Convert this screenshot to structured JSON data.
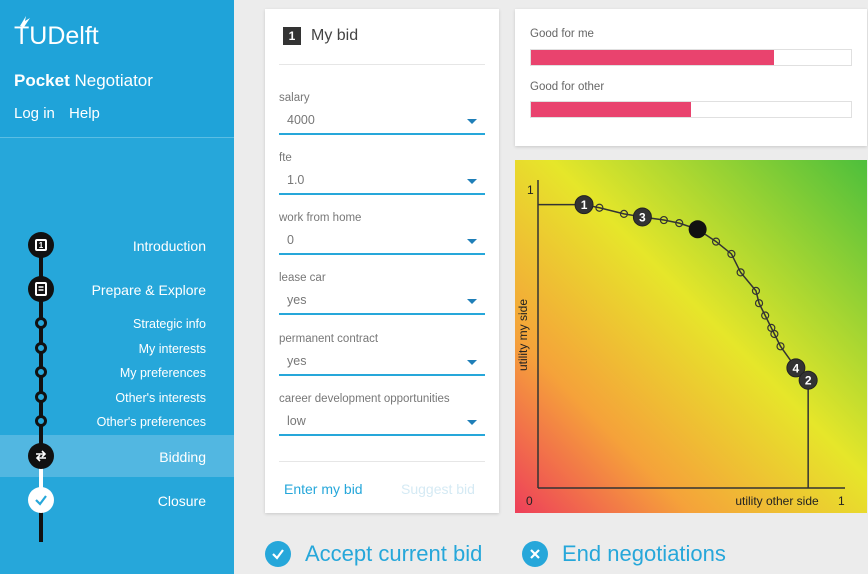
{
  "sidebar": {
    "logo": "TUDelft",
    "app_title_bold": "Pocket",
    "app_title_rest": " Negotiator",
    "login": "Log in",
    "help": "Help",
    "steps": {
      "introduction": "Introduction",
      "prepare": "Prepare & Explore",
      "strategic": "Strategic info",
      "my_interests": "My interests",
      "my_preferences": "My preferences",
      "others_interests": "Other's interests",
      "others_preferences": "Other's preferences",
      "bidding": "Bidding",
      "closure": "Closure"
    },
    "step1_badge": "1"
  },
  "bid": {
    "badge": "1",
    "title": "My bid",
    "fields": [
      {
        "label": "salary",
        "value": "4000"
      },
      {
        "label": "fte",
        "value": "1.0"
      },
      {
        "label": "work from home",
        "value": "0"
      },
      {
        "label": "lease car",
        "value": "yes"
      },
      {
        "label": "permanent contract",
        "value": "yes"
      },
      {
        "label": "career development opportunities",
        "value": "low"
      }
    ],
    "enter_label": "Enter my bid",
    "suggest_label": "Suggest bid"
  },
  "utility": {
    "me_label": "Good for me",
    "me_value": 0.76,
    "other_label": "Good for other",
    "other_value": 0.5,
    "bar_color": "#e9436e"
  },
  "chart_data": {
    "type": "scatter",
    "xlabel": "utility other side",
    "ylabel": "utility my side",
    "x_tick_min": "0",
    "x_tick_max": "1",
    "y_tick_max": "1",
    "xlim": [
      0,
      1
    ],
    "ylim": [
      0,
      1
    ],
    "pareto_points": [
      {
        "x": 0.0,
        "y": 0.92
      },
      {
        "x": 0.15,
        "y": 0.92,
        "label": "1"
      },
      {
        "x": 0.2,
        "y": 0.91
      },
      {
        "x": 0.28,
        "y": 0.89
      },
      {
        "x": 0.34,
        "y": 0.88,
        "label": "3"
      },
      {
        "x": 0.41,
        "y": 0.87
      },
      {
        "x": 0.46,
        "y": 0.86
      },
      {
        "x": 0.52,
        "y": 0.84,
        "highlight": true
      },
      {
        "x": 0.58,
        "y": 0.8
      },
      {
        "x": 0.63,
        "y": 0.76
      },
      {
        "x": 0.66,
        "y": 0.7
      },
      {
        "x": 0.71,
        "y": 0.64
      },
      {
        "x": 0.72,
        "y": 0.6
      },
      {
        "x": 0.74,
        "y": 0.56
      },
      {
        "x": 0.76,
        "y": 0.52
      },
      {
        "x": 0.77,
        "y": 0.5
      },
      {
        "x": 0.79,
        "y": 0.46
      },
      {
        "x": 0.84,
        "y": 0.39,
        "label": "4"
      },
      {
        "x": 0.88,
        "y": 0.35,
        "label": "2"
      },
      {
        "x": 0.88,
        "y": 0.0
      }
    ],
    "background_gradient": [
      "#4dbf3c",
      "#e6e62a",
      "#f28a3c",
      "#ee3f5a"
    ]
  },
  "actions": {
    "accept": "Accept current bid",
    "end": "End negotiations",
    "color": "#26a7da"
  }
}
